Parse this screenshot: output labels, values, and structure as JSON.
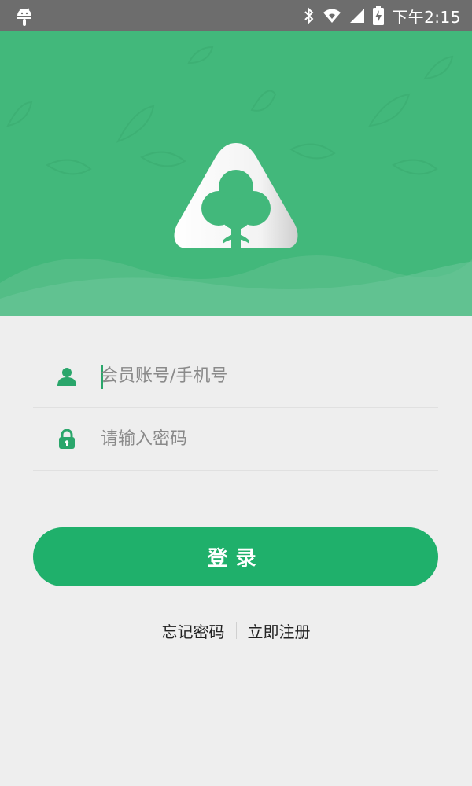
{
  "status_bar": {
    "time": "下午2:15",
    "icons": [
      "android-icon",
      "bluetooth-icon",
      "wifi-icon",
      "cellular-signal-icon",
      "battery-charging-icon"
    ]
  },
  "login": {
    "account_placeholder": "会员账号/手机号",
    "password_placeholder": "请输入密码",
    "login_button": "登录",
    "forgot_password": "忘记密码",
    "register": "立即注册"
  },
  "colors": {
    "header_green": "#42b87b",
    "button_green": "#1fb06b",
    "background": "#eeeeee",
    "status_bar": "#6d6d6d"
  }
}
